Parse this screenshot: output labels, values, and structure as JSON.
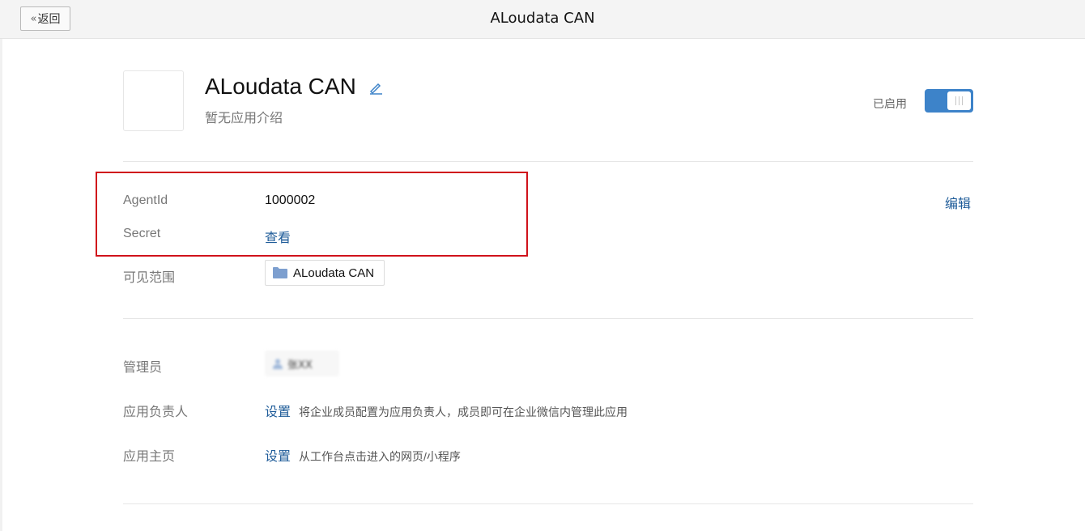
{
  "topbar": {
    "back_label": "返回",
    "title": "ALoudata CAN"
  },
  "app": {
    "name": "ALoudata CAN",
    "description": "暂无应用介绍",
    "status_label": "已启用",
    "enabled": true
  },
  "credentials": {
    "agentid_label": "AgentId",
    "agentid_value": "1000002",
    "secret_label": "Secret",
    "secret_link": "查看",
    "edit_link": "编辑"
  },
  "visibility": {
    "label": "可见范围",
    "scope_name": "ALoudata CAN"
  },
  "management": {
    "admin_label": "管理员",
    "admin_name": "张XX",
    "owner_label": "应用负责人",
    "owner_link": "设置",
    "owner_hint": "将企业成员配置为应用负责人，成员即可在企业微信内管理此应用",
    "homepage_label": "应用主页",
    "homepage_link": "设置",
    "homepage_hint": "从工作台点击进入的网页/小程序"
  },
  "colors": {
    "accent": "#3d83c9",
    "link": "#1f5c99",
    "highlight_border": "#d0121b"
  }
}
